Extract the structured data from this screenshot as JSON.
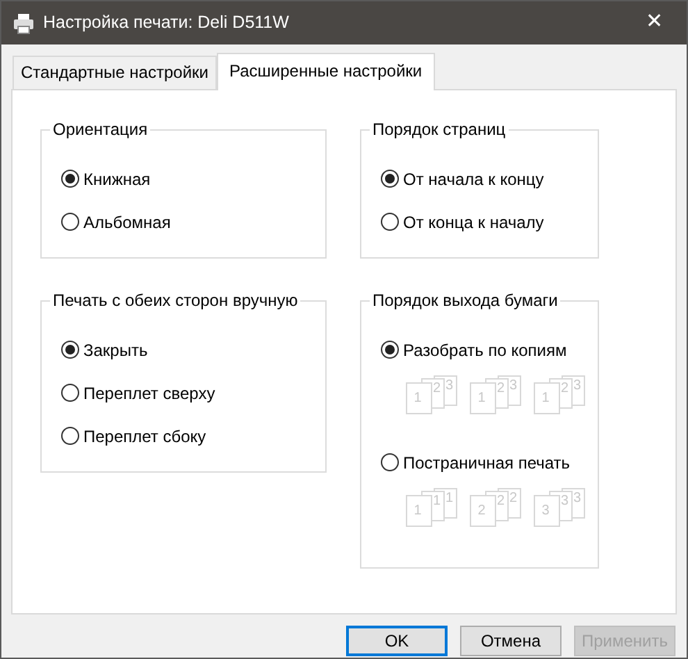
{
  "window": {
    "title": "Настройка печати: Deli D511W",
    "close": "✕"
  },
  "tabs": [
    {
      "label": "Стандартные настройки",
      "selected": false
    },
    {
      "label": "Расширенные настройки",
      "selected": true
    }
  ],
  "groups": [
    {
      "title": "Ориентация",
      "options": [
        {
          "label": "Книжная",
          "selected": true
        },
        {
          "label": "Альбомная",
          "selected": false
        }
      ]
    },
    {
      "title": "Печать с обеих сторон вручную",
      "options": [
        {
          "label": "Закрыть",
          "selected": true
        },
        {
          "label": "Переплет сверху",
          "selected": false
        },
        {
          "label": "Переплет сбоку",
          "selected": false
        }
      ]
    },
    {
      "title": "Порядок страниц",
      "options": [
        {
          "label": "От начала к концу",
          "selected": true
        },
        {
          "label": "От конца к началу",
          "selected": false
        }
      ]
    },
    {
      "title": "Порядок выхода бумаги",
      "options": [
        {
          "label": "Разобрать по копиям",
          "selected": true,
          "stacks": [
            [
              "1",
              "2",
              "3"
            ],
            [
              "1",
              "2",
              "3"
            ],
            [
              "1",
              "2",
              "3"
            ]
          ]
        },
        {
          "label": "Постраничная печать",
          "selected": false,
          "stacks": [
            [
              "1",
              "1",
              "1"
            ],
            [
              "2",
              "2",
              "2"
            ],
            [
              "3",
              "3",
              "3"
            ]
          ]
        }
      ]
    }
  ],
  "buttons": [
    {
      "label": "OK",
      "kind": "default"
    },
    {
      "label": "Отмена",
      "kind": "normal"
    },
    {
      "label": "Применить",
      "kind": "disabled"
    }
  ]
}
